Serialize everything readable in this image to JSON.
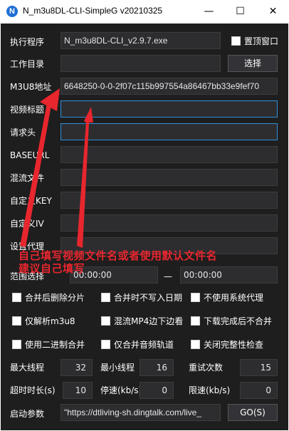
{
  "window": {
    "title": "N_m3u8DL-CLI-SimpleG v20210325",
    "icon_letter": "N",
    "minimize": "—",
    "maximize": "☐",
    "close": "✕"
  },
  "rows": {
    "exe_label": "执行程序",
    "exe_value": "N_m3u8DL-CLI_v2.9.7.exe",
    "topmost_label": "置顶窗口",
    "workdir_label": "工作目录",
    "workdir_value": "",
    "browse_label": "选择",
    "m3u8_label": "M3U8地址",
    "m3u8_value": "6648250-0-0-2f07c115b997554a86467bb33e9fef70",
    "title_label": "视频标题",
    "title_value": "",
    "header_label": "请求头",
    "header_value": "",
    "baseurl_label": "BASEURL",
    "baseurl_value": "",
    "mux_label": "混流文件",
    "mux_value": "",
    "key_label": "自定义KEY",
    "key_value": "",
    "iv_label": "自定义IV",
    "iv_value": "",
    "proxy_label": "设置代理",
    "proxy_value": "",
    "range_label": "范围选择",
    "range_start": "00:00:00",
    "range_sep": "—",
    "range_end": "00:00:00"
  },
  "options": [
    "合并后删除分片",
    "合并时不写入日期",
    "不使用系统代理",
    "仅解析m3u8",
    "混流MP4边下边看",
    "下载完成后不合并",
    "使用二进制合并",
    "仅合并音频轨道",
    "关闭完整性检查"
  ],
  "numbers": {
    "max_threads_label": "最大线程",
    "max_threads": "32",
    "min_threads_label": "最小线程",
    "min_threads": "16",
    "retry_label": "重试次数",
    "retry": "15",
    "timeout_label": "超时时长(s)",
    "timeout": "10",
    "stop_speed_label": "停速(kb/s)",
    "stop_speed": "0",
    "limit_speed_label": "限速(kb/s)",
    "limit_speed": "0"
  },
  "footer": {
    "params_label": "启动参数",
    "params_value": "\"https://dtliving-sh.dingtalk.com/live_",
    "go_label": "GO(S)"
  },
  "annotation": {
    "line1": "自己填写视频文件名或者使用默认文件名",
    "line2": "建议自己填写",
    "color": "#e8262e"
  }
}
